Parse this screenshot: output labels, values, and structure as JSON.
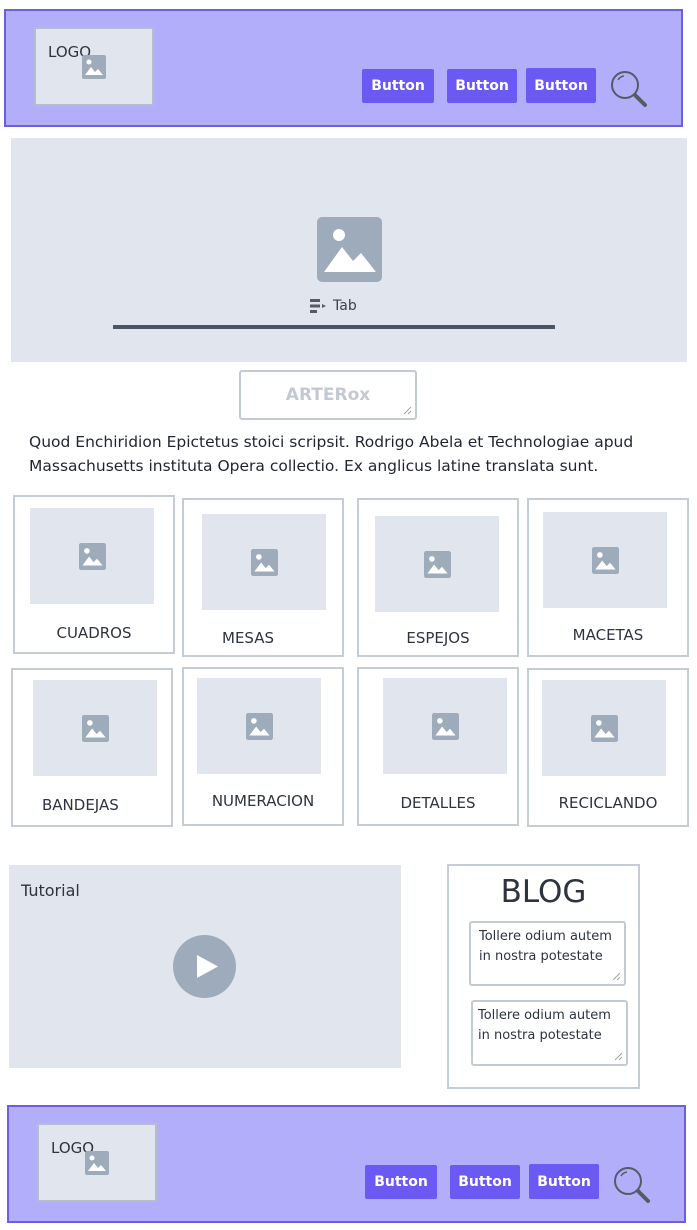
{
  "header": {
    "logo": "LOGO",
    "buttons": [
      "Button",
      "Button",
      "Button"
    ]
  },
  "hero": {
    "tab_label": "Tab"
  },
  "brand_field": {
    "value": "ARTERox"
  },
  "intro_text": "Quod Enchiridion Epictetus stoici scripsit. Rodrigo Abela et Technologiae apud Massachusetts instituta Opera collectio. Ex anglicus latine translata sunt.",
  "categories": [
    "CUADROS",
    "MESAS",
    "ESPEJOS",
    "MACETAS",
    "BANDEJAS",
    "NUMERACION",
    "DETALLES",
    "RECICLANDO"
  ],
  "video": {
    "title": "Tutorial"
  },
  "blog": {
    "title": "BLOG",
    "posts": [
      "Tollere odium autem in nostra potestate",
      "Tollere odium autem in nostra potestate"
    ]
  },
  "footer": {
    "logo": "LOGO",
    "buttons": [
      "Button",
      "Button",
      "Button"
    ]
  },
  "colors": {
    "nav_background": "#b3aef9",
    "nav_border": "#6a5fe0",
    "button": "#6a59f2",
    "placeholder": "#e1e6ee",
    "placeholder_icon": "#9eabba"
  }
}
